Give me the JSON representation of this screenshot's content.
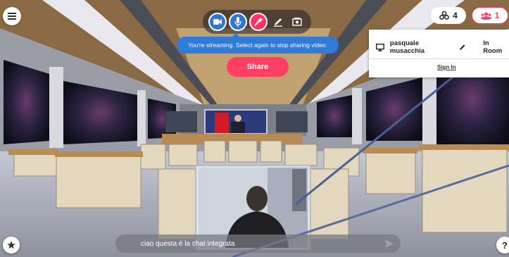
{
  "toolbar": {
    "items": [
      "camera-icon",
      "microphone-icon",
      "magic-wand-icon",
      "pencil-icon",
      "media-frame-icon"
    ]
  },
  "tooltip": {
    "text": "You're streaming. Select again to stop sharing video."
  },
  "share": {
    "label": "Share"
  },
  "objects": {
    "count": "4",
    "icon": "objects-icon"
  },
  "people": {
    "count": "1",
    "icon": "people-icon"
  },
  "people_panel": {
    "member": {
      "name": "pasquale musacchia",
      "presence": "In Room"
    },
    "sign_in": "Sign In"
  },
  "chat": {
    "value": "ciao questa è la chat integrata"
  },
  "help": {
    "label": "?"
  },
  "colors": {
    "accent": "#ff3f63",
    "brand_blue": "#2f7bd9"
  }
}
